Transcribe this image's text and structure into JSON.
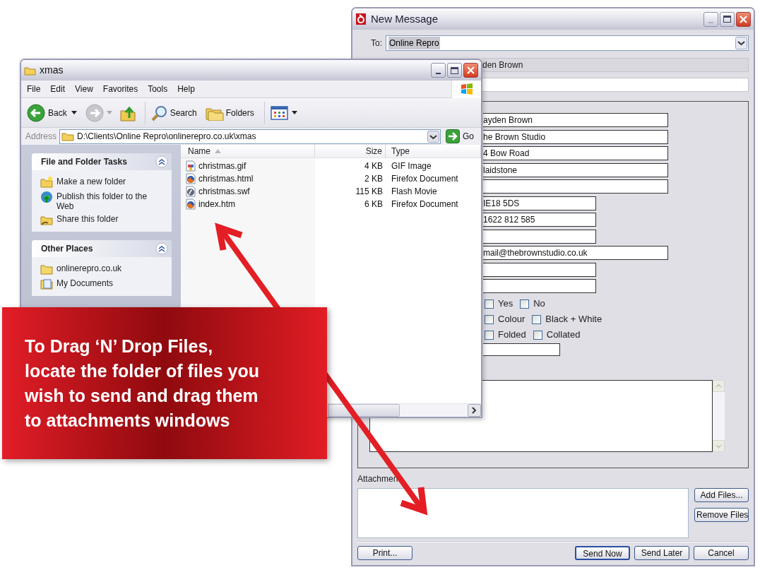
{
  "message_window": {
    "title": "New Message",
    "to_label": "To:",
    "to_value": "Online Repro",
    "from_value": "den Brown",
    "fields": [
      {
        "kind": "long",
        "value": "ayden Brown"
      },
      {
        "kind": "long",
        "value": "he Brown Studio"
      },
      {
        "kind": "long",
        "value": "4 Bow Road"
      },
      {
        "kind": "long",
        "value": "laidstone"
      },
      {
        "kind": "long"
      },
      {
        "kind": "short",
        "value": "IE18 5DS"
      },
      {
        "kind": "short",
        "value": "1622 812 585"
      },
      {
        "kind": "short"
      },
      {
        "kind": "long",
        "value": "mail@thebrownstudio.co.uk"
      },
      {
        "kind": "short"
      },
      {
        "kind": "short"
      }
    ],
    "checkbox_rows": [
      [
        {
          "label": "Yes",
          "checked": false
        },
        {
          "label": "No",
          "checked": false
        }
      ],
      [
        {
          "label": "Colour",
          "checked": false
        },
        {
          "label": "Black + White",
          "checked": false
        }
      ],
      [
        {
          "label": "Folded",
          "checked": false
        },
        {
          "label": "Collated",
          "checked": false
        }
      ]
    ],
    "attachments_label": "Attachmen",
    "side_buttons": [
      "Add Files...",
      "Remove Files"
    ],
    "print_button": "Print...",
    "bottom_buttons": [
      "Send Now",
      "Send Later",
      "Cancel"
    ]
  },
  "explorer_window": {
    "title": "xmas",
    "menu": [
      "File",
      "Edit",
      "View",
      "Favorites",
      "Tools",
      "Help"
    ],
    "toolbar": {
      "back": "Back",
      "search": "Search",
      "folders": "Folders"
    },
    "address_label": "Address",
    "address": "D:\\Clients\\Online Repro\\onlinerepro.co.uk\\xmas",
    "go": "Go",
    "panels": [
      {
        "title": "File and Folder Tasks",
        "items": [
          {
            "kind": "new-folder",
            "label": "Make a new folder"
          },
          {
            "kind": "publish",
            "label": "Publish this folder to the Web"
          },
          {
            "kind": "share",
            "label": "Share this folder"
          }
        ]
      },
      {
        "title": "Other Places",
        "items": [
          {
            "kind": "folder",
            "label": "onlinerepro.co.uk"
          },
          {
            "kind": "documents",
            "label": "My Documents"
          }
        ]
      }
    ],
    "columns": [
      {
        "label": "Name",
        "sorted": true
      },
      {
        "label": "Size",
        "sorted": false
      },
      {
        "label": "Type",
        "sorted": false
      }
    ],
    "files": [
      {
        "kind": "image",
        "name": "christmas.gif",
        "size": "4 KB",
        "type": "GIF Image"
      },
      {
        "kind": "web",
        "name": "christmas.html",
        "size": "2 KB",
        "type": "Firefox Document"
      },
      {
        "kind": "movie",
        "name": "christmas.swf",
        "size": "115 KB",
        "type": "Flash Movie"
      },
      {
        "kind": "web",
        "name": "index.htm",
        "size": "6 KB",
        "type": "Firefox Document"
      }
    ]
  },
  "callout": {
    "text": "To Drag ‘N’ Drop Files,\nlocate the folder of files you\nwish to send and drag them\nto attachments windows"
  }
}
